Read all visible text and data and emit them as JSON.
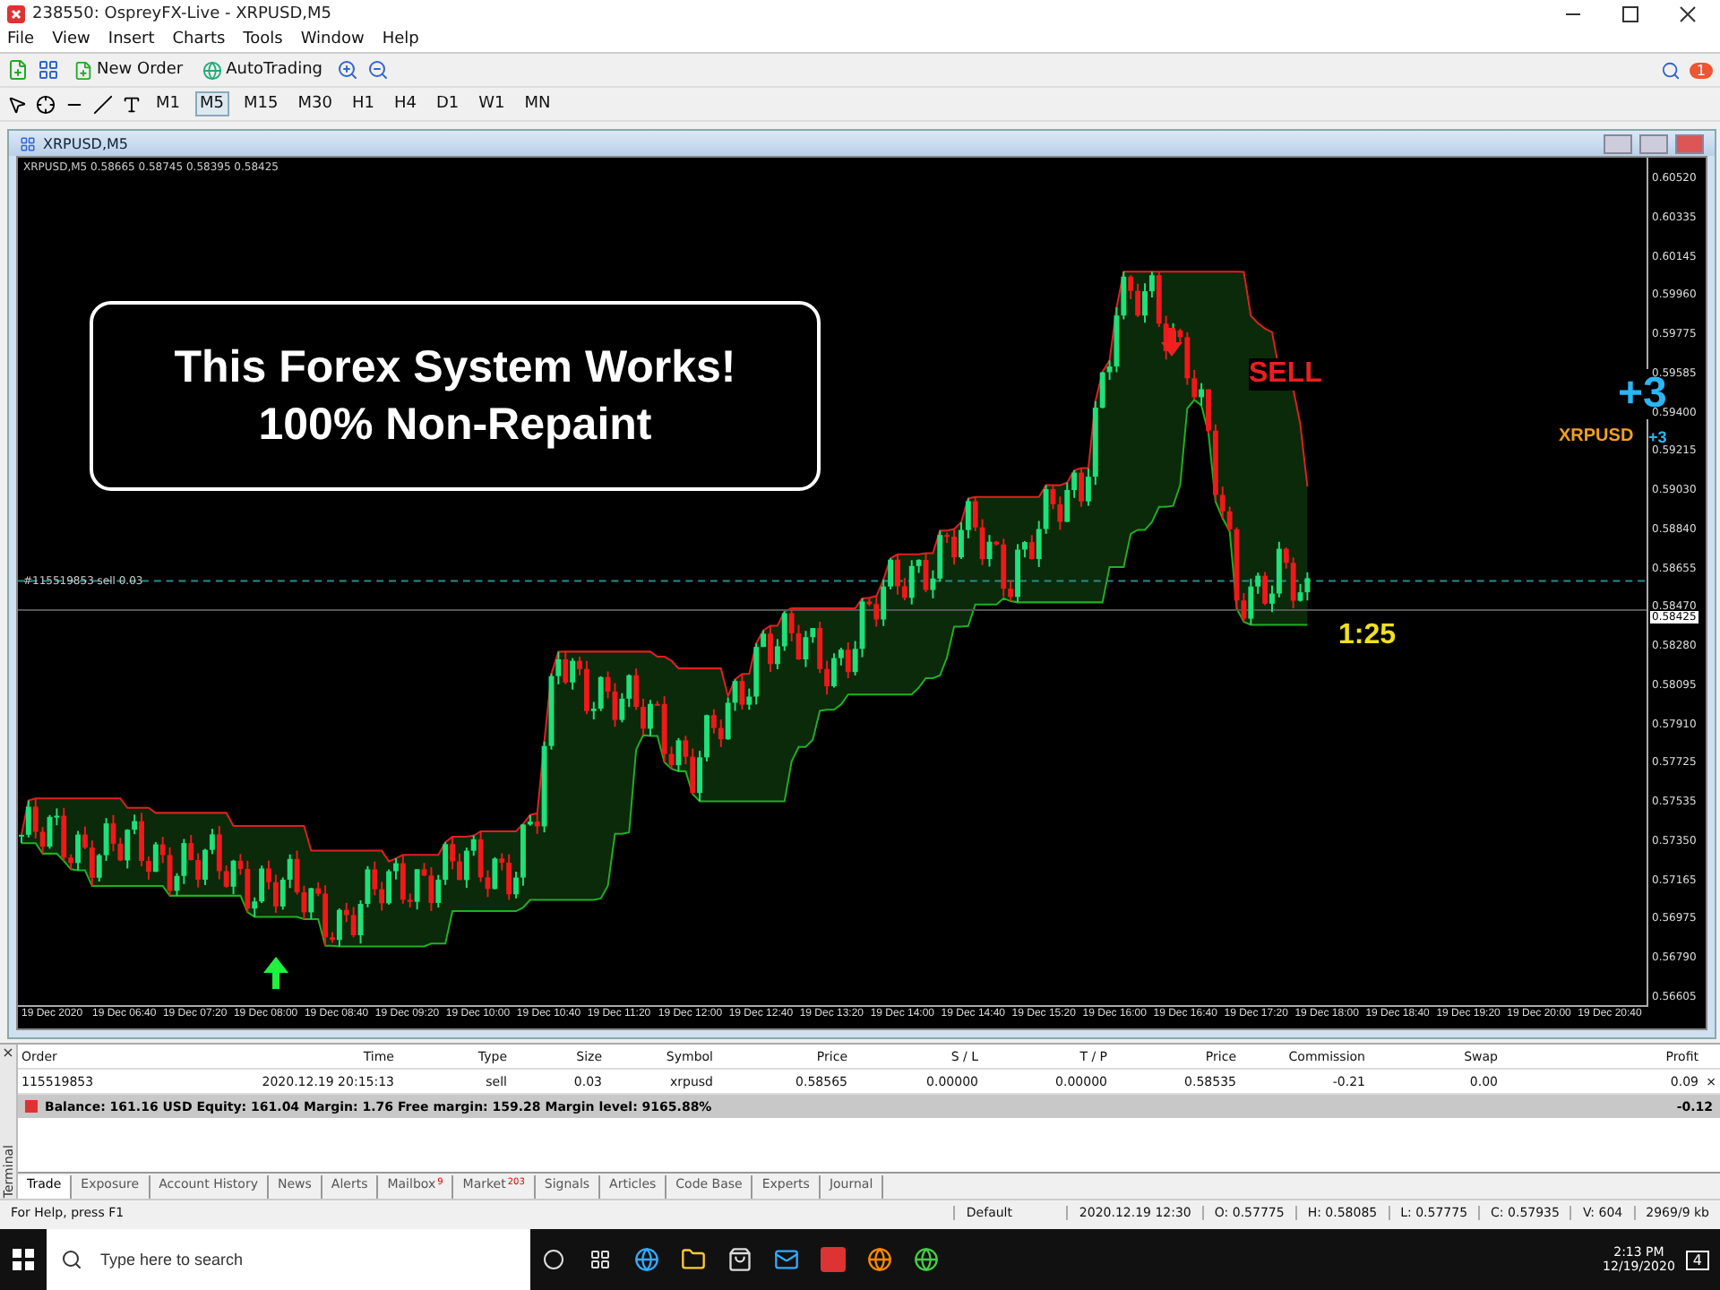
{
  "window": {
    "title": "238550: OspreyFX-Live - XRPUSD,M5"
  },
  "menu": [
    "File",
    "View",
    "Insert",
    "Charts",
    "Tools",
    "Window",
    "Help"
  ],
  "toolbar": {
    "new_order": "New Order",
    "autotrading": "AutoTrading",
    "notifications": "1"
  },
  "timeframes": [
    {
      "label": "M1",
      "selected": false
    },
    {
      "label": "M5",
      "selected": true
    },
    {
      "label": "M15",
      "selected": false
    },
    {
      "label": "M30",
      "selected": false
    },
    {
      "label": "H1",
      "selected": false
    },
    {
      "label": "H4",
      "selected": false
    },
    {
      "label": "D1",
      "selected": false
    },
    {
      "label": "W1",
      "selected": false
    },
    {
      "label": "MN",
      "selected": false
    }
  ],
  "chart_window": {
    "title": "XRPUSD,M5",
    "header": "XRPUSD,M5  0.58665 0.58745 0.58395 0.58425",
    "order_line": "#115519853 sell 0.03",
    "callout": [
      "This Forex System Works!",
      "100% Non-Repaint"
    ],
    "signal": "SELL",
    "ratio": "1:25",
    "score": "+3",
    "symbol": "XRPUSD",
    "symbol_score": "+3",
    "current_price": "0.58425",
    "price_axis": [
      "0.60520",
      "0.60335",
      "0.60145",
      "0.59960",
      "0.59775",
      "0.59585",
      "0.59400",
      "0.59215",
      "0.59030",
      "0.58840",
      "0.58655",
      "0.58470",
      "0.58280",
      "0.58095",
      "0.57910",
      "0.57725",
      "0.57535",
      "0.57350",
      "0.57165",
      "0.56975",
      "0.56790",
      "0.56605"
    ],
    "time_axis": [
      "19 Dec 2020",
      "19 Dec 06:40",
      "19 Dec 07:20",
      "19 Dec 08:00",
      "19 Dec 08:40",
      "19 Dec 09:20",
      "19 Dec 10:00",
      "19 Dec 10:40",
      "19 Dec 11:20",
      "19 Dec 12:00",
      "19 Dec 12:40",
      "19 Dec 13:20",
      "19 Dec 14:00",
      "19 Dec 14:40",
      "19 Dec 15:20",
      "19 Dec 16:00",
      "19 Dec 16:40",
      "19 Dec 17:20",
      "19 Dec 18:00",
      "19 Dec 18:40",
      "19 Dec 19:20",
      "19 Dec 20:00",
      "19 Dec 20:40"
    ]
  },
  "terminal": {
    "label": "Terminal",
    "close": "×",
    "columns": [
      "Order",
      "Time",
      "Type",
      "Size",
      "Symbol",
      "Price",
      "S / L",
      "T / P",
      "Price",
      "Commission",
      "Swap",
      "Profit"
    ],
    "rows": [
      {
        "cells": [
          "115519853",
          "2020.12.19 20:15:13",
          "sell",
          "0.03",
          "xrpusd",
          "0.58565",
          "0.00000",
          "0.00000",
          "0.58535",
          "-0.21",
          "0.00",
          "0.09"
        ],
        "close": "×"
      }
    ],
    "balance": {
      "text": "Balance: 161.16 USD  Equity: 161.04  Margin: 1.76  Free margin: 159.28  Margin level: 9165.88%",
      "profit": "-0.12"
    },
    "tabs": [
      {
        "label": "Trade",
        "selected": true
      },
      {
        "label": "Exposure",
        "selected": false
      },
      {
        "label": "Account History",
        "selected": false
      },
      {
        "label": "News",
        "selected": false
      },
      {
        "label": "Alerts",
        "selected": false
      },
      {
        "label": "Mailbox",
        "badge": "9",
        "selected": false
      },
      {
        "label": "Market",
        "badge": "203",
        "selected": false
      },
      {
        "label": "Signals",
        "selected": false
      },
      {
        "label": "Articles",
        "selected": false
      },
      {
        "label": "Code Base",
        "selected": false
      },
      {
        "label": "Experts",
        "selected": false
      },
      {
        "label": "Journal",
        "selected": false
      }
    ]
  },
  "status_bar": {
    "help": "For Help, press F1",
    "profile": "Default",
    "time": "2020.12.19 12:30",
    "open": "O: 0.57775",
    "high": "H: 0.58085",
    "low": "L: 0.57775",
    "close": "C: 0.57935",
    "volume": "V: 604",
    "traffic": "2969/9 kb"
  },
  "taskbar": {
    "search_placeholder": "Type here to search",
    "clock": "2:13 PM",
    "date": "12/19/2020",
    "notifications": "4"
  }
}
